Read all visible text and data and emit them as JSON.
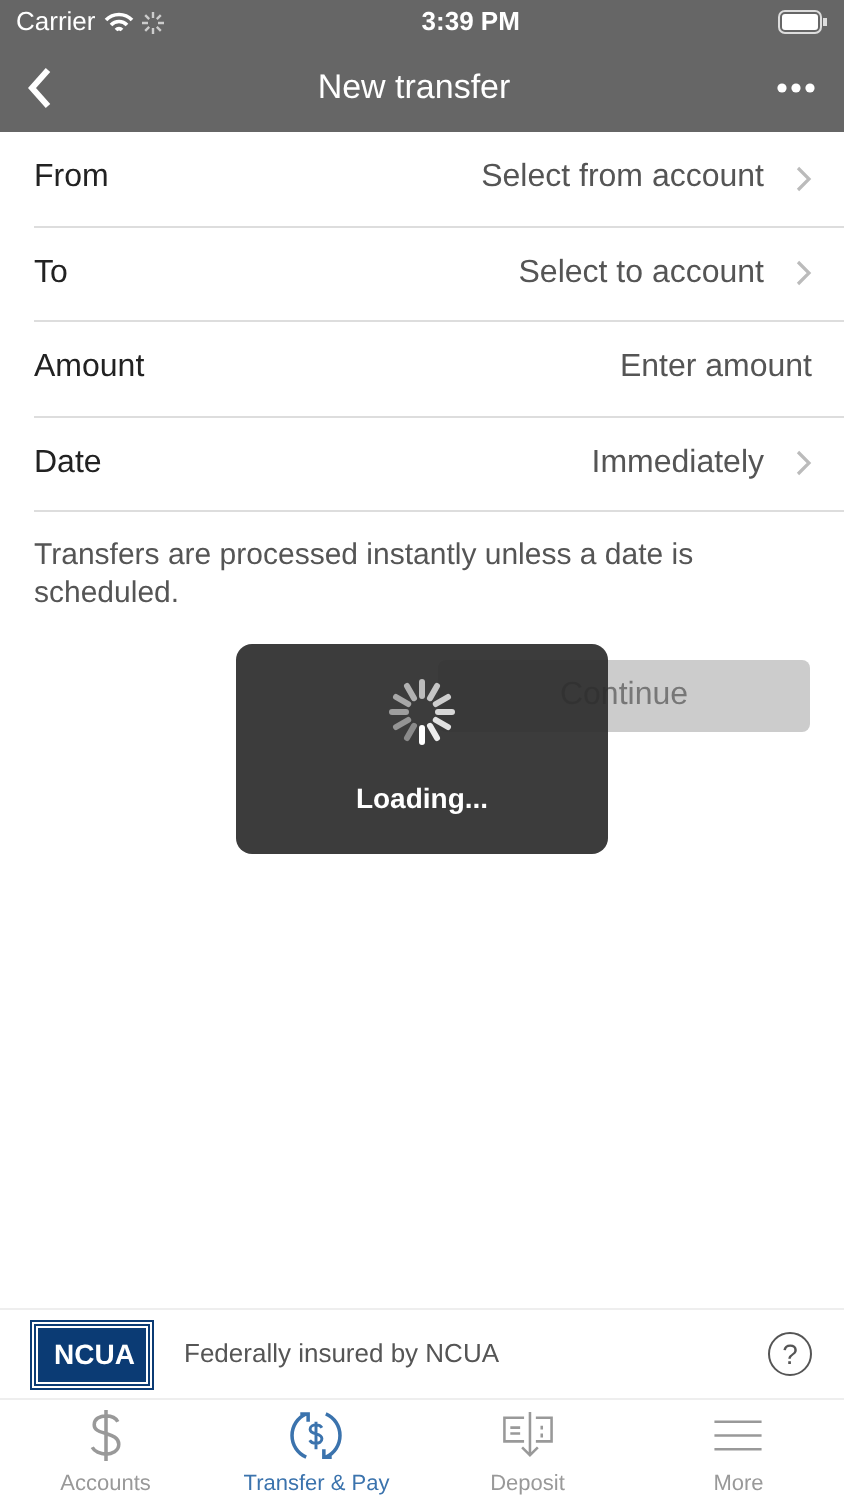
{
  "status_bar": {
    "carrier": "Carrier",
    "time": "3:39 PM"
  },
  "nav": {
    "title": "New transfer"
  },
  "fields": [
    {
      "label": "From",
      "kind": "select",
      "value": "Select from account"
    },
    {
      "label": "To",
      "kind": "select",
      "value": "Select to account"
    },
    {
      "label": "Amount",
      "kind": "input",
      "placeholder": "Enter amount"
    },
    {
      "label": "Date",
      "kind": "select",
      "value": "Immediately"
    }
  ],
  "note": "Transfers are processed instantly unless a date is scheduled.",
  "continue_button": {
    "label": "Continue",
    "disabled": true
  },
  "loading": {
    "text": "Loading..."
  },
  "footer": {
    "badge": "NCUA",
    "text": "Federally insured by NCUA",
    "help": "?"
  },
  "tabs": [
    {
      "label": "Accounts",
      "kind": "dollar",
      "selected": false
    },
    {
      "label": "Transfer & Pay",
      "kind": "transfer",
      "selected": true
    },
    {
      "label": "Deposit",
      "kind": "deposit",
      "selected": false
    },
    {
      "label": "More",
      "kind": "more",
      "selected": false
    }
  ]
}
